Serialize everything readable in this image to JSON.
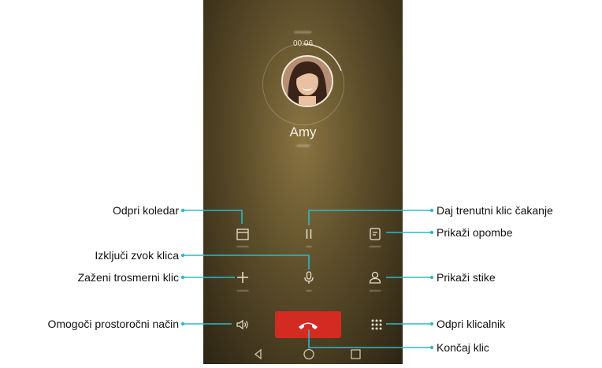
{
  "call": {
    "contact_name": "Amy",
    "timer": "00:06"
  },
  "callouts": {
    "calendar": "Odpri koledar",
    "hold": "Daj trenutni klic čakanje",
    "notes": "Prikaži opombe",
    "mute": "Izključi zvok klica",
    "add_call": "Zaženi trosmerni klic",
    "contacts": "Prikaži stike",
    "speaker": "Omogoči prostoročni način",
    "dialpad": "Odpri klicalnik",
    "end_call": "Končaj klic"
  },
  "colors": {
    "callout_line": "#2fb8c9",
    "end_call": "#d32b22",
    "background_gold": "#8a7441"
  },
  "icons": [
    "calendar-icon",
    "pause-icon",
    "notepad-icon",
    "microphone-icon",
    "plus-icon",
    "contact-icon",
    "speaker-icon",
    "dialpad-icon",
    "end-call-icon",
    "back-icon",
    "home-icon",
    "recents-icon"
  ]
}
